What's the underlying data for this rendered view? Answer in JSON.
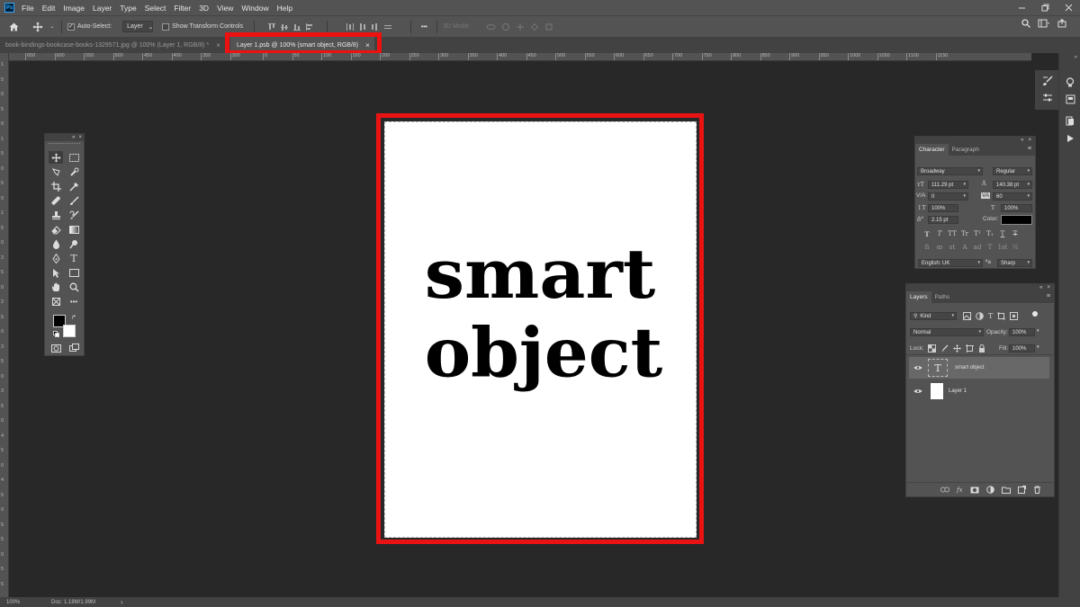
{
  "app": {
    "logo": "Ps"
  },
  "menu": [
    "File",
    "Edit",
    "Image",
    "Layer",
    "Type",
    "Select",
    "Filter",
    "3D",
    "View",
    "Window",
    "Help"
  ],
  "options_bar": {
    "auto_select_label": "Auto-Select:",
    "auto_select_checked": true,
    "auto_select_target": "Layer",
    "show_transform_label": "Show Transform Controls",
    "mode_3d_label": "3D Mode:",
    "more": "•••"
  },
  "tabs": [
    {
      "title": "book-bindings-bookcase-books-1329571.jpg @ 100% (Layer 1, RGB/8) *",
      "close": "×",
      "active": false
    },
    {
      "title": "Layer 1.psb @ 100% (smart object, RGB/8)",
      "close": "×",
      "active": true
    }
  ],
  "rulers": {
    "horizontal": [
      "650",
      "600",
      "550",
      "500",
      "450",
      "400",
      "350",
      "300",
      "0",
      "50",
      "100",
      "150",
      "200",
      "250",
      "300",
      "350",
      "400",
      "450",
      "500",
      "550",
      "600",
      "650",
      "700",
      "750",
      "800",
      "850",
      "900",
      "950",
      "1000",
      "1050",
      "1100",
      "1150"
    ],
    "vertical": [
      "1",
      "5",
      "0",
      "5",
      "0",
      "1",
      "5",
      "0",
      "5",
      "0",
      "1",
      "5",
      "0",
      "2",
      "5",
      "0",
      "2",
      "5",
      "0",
      "3",
      "5",
      "0",
      "3",
      "5",
      "0",
      "4",
      "5",
      "0",
      "4",
      "5",
      "0",
      "5",
      "5",
      "0",
      "5",
      "5"
    ]
  },
  "document": {
    "text_line1": "smart",
    "text_line2": "object",
    "highlight_color": "#e91313"
  },
  "status_bar": {
    "zoom": "100%",
    "doc": "Doc: 1.18M/1.99M",
    "arrow": "›"
  },
  "character_panel": {
    "tabs": [
      "Character",
      "Paragraph"
    ],
    "font_family": "Broadway",
    "font_style": "Regular",
    "font_size": "111.29 pt",
    "leading": "140.38 pt",
    "kerning": "0",
    "tracking": "60",
    "vertical_scale": "100%",
    "horizontal_scale": "100%",
    "baseline_shift": "2.15 pt",
    "color_label": "Color:",
    "text_color": "#000000",
    "language": "English: UK",
    "aa_label": "ªa",
    "antialias": "Sharp",
    "type_styles": [
      "T",
      "T",
      "TT",
      "Tr",
      "T¹",
      "T₁",
      "T",
      "T"
    ],
    "opentype": [
      "fi",
      "ꝏ",
      "st",
      "A",
      "ad",
      "T",
      "1st",
      "½"
    ]
  },
  "layers_panel": {
    "tabs": [
      "Layers",
      "Paths"
    ],
    "filter_kind": "Kind",
    "blend_mode": "Normal",
    "opacity_label": "Opacity:",
    "opacity": "100%",
    "lock_label": "Lock:",
    "fill_label": "Fill:",
    "fill": "100%",
    "layers": [
      {
        "name": "smart object",
        "type": "text",
        "thumb": "T",
        "selected": true
      },
      {
        "name": "Layer 1",
        "type": "pixel",
        "thumb": "",
        "selected": false
      }
    ],
    "footer": [
      "link",
      "fx",
      "mask",
      "adjust",
      "folder",
      "new",
      "trash"
    ]
  }
}
